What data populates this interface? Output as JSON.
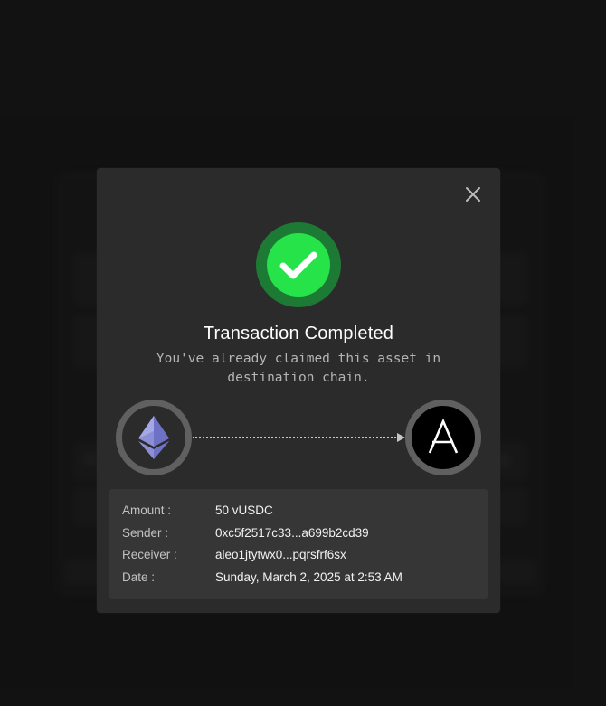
{
  "modal": {
    "title": "Transaction Completed",
    "subtitle": "You've already claimed this asset in destination chain.",
    "close_icon": "close-icon",
    "status_icon": "checkmark-icon",
    "colors": {
      "success_outer": "#1d7a35",
      "success_inner": "#27e34a",
      "modal_bg": "#2b2b2b",
      "details_bg": "#363636"
    }
  },
  "transfer": {
    "source_chain_icon": "ethereum-icon",
    "destination_chain_icon": "aleo-icon",
    "destination_letter": "A",
    "arrow_icon": "arrow-right-icon"
  },
  "details": {
    "rows": [
      {
        "label": "Amount :",
        "value": "50 vUSDC"
      },
      {
        "label": "Sender :",
        "value": "0xc5f2517c33...a699b2cd39"
      },
      {
        "label": "Receiver :",
        "value": "aleo1jtytwx0...pqrsfrf6sx"
      },
      {
        "label": "Date :",
        "value": "Sunday, March 2, 2025 at 2:53 AM"
      }
    ]
  }
}
